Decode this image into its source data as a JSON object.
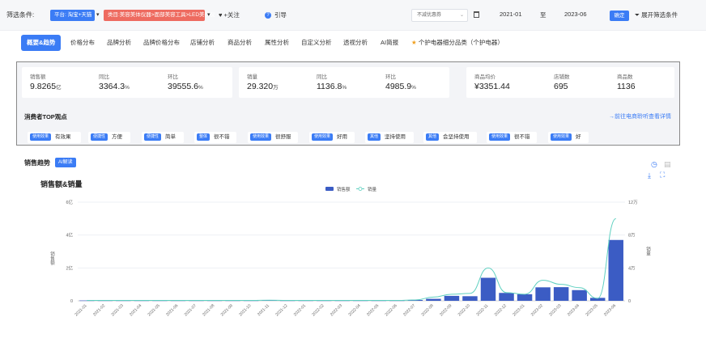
{
  "filter_bar": {
    "label": "筛选条件:",
    "platform_tag": "平台: 淘宝+天猫",
    "category_tag": "类目:美容美体仪器>面部美容工具>LED美容仪",
    "follow": "+关注",
    "guide": "引导",
    "coupon": {
      "value": "不减优惠券"
    },
    "date_from": "2021-01",
    "date_sep": "至",
    "date_to": "2023-06",
    "confirm": "确定",
    "expand": "展开筛选条件"
  },
  "tabs": [
    {
      "label": "概要&趋势",
      "active": true
    },
    {
      "label": "价格分布"
    },
    {
      "label": "品牌分析"
    },
    {
      "label": "品牌价格分布"
    },
    {
      "label": "店铺分析"
    },
    {
      "label": "商品分析"
    },
    {
      "label": "属性分析"
    },
    {
      "label": "自定义分析"
    },
    {
      "label": "透视分析"
    },
    {
      "label": "AI简报"
    },
    {
      "label": "个护电器细分品类（个护电器）",
      "starred": true
    }
  ],
  "metrics": {
    "sales": [
      {
        "label": "销售额",
        "value": "9.8265",
        "unit": "亿"
      },
      {
        "label": "同比",
        "value": "3364.3",
        "unit": "%"
      },
      {
        "label": "环比",
        "value": "39555.6",
        "unit": "%"
      }
    ],
    "volume": [
      {
        "label": "销量",
        "value": "29.320",
        "unit": "万"
      },
      {
        "label": "同比",
        "value": "1136.8",
        "unit": "%"
      },
      {
        "label": "环比",
        "value": "4985.9",
        "unit": "%"
      }
    ],
    "other": [
      {
        "label": "商品均价",
        "value": "¥3351.44"
      },
      {
        "label": "店铺数",
        "value": "695"
      },
      {
        "label": "商品数",
        "value": "1136"
      }
    ]
  },
  "opinions": {
    "title": "消费者TOP观点",
    "link": "→前往电商聆听查看详情",
    "chips": [
      {
        "tag": "使用效果",
        "text": "有效果"
      },
      {
        "tag": "便捷性",
        "text": "方便"
      },
      {
        "tag": "便捷性",
        "text": "简单"
      },
      {
        "tag": "整体",
        "text": "很不错"
      },
      {
        "tag": "使用效果",
        "text": "很舒服"
      },
      {
        "tag": "使用效果",
        "text": "好用"
      },
      {
        "tag": "其他",
        "text": "坚持使用"
      },
      {
        "tag": "其他",
        "text": "会坚持使用"
      },
      {
        "tag": "使用效果",
        "text": "很不错"
      },
      {
        "tag": "使用效果",
        "text": "好"
      }
    ]
  },
  "trend": {
    "title": "销售趋势",
    "ai_badge": "AI解读"
  },
  "chart_data": {
    "type": "bar",
    "title": "销售额&销量",
    "legend": [
      "销售额",
      "销量"
    ],
    "legend_placement": "top-center",
    "ylabel_left": "销售额",
    "ylabel_right": "销量",
    "y_left_ticks": [
      "0",
      "2亿",
      "4亿",
      "6亿"
    ],
    "y_right_ticks": [
      "0",
      "4万",
      "8万",
      "12万"
    ],
    "ylim_left": [
      0,
      6
    ],
    "ylim_right": [
      0,
      12
    ],
    "categories": [
      "2021-01",
      "2021-02",
      "2021-03",
      "2021-04",
      "2021-05",
      "2021-06",
      "2021-07",
      "2021-08",
      "2021-09",
      "2021-10",
      "2021-11",
      "2021-12",
      "2022-01",
      "2022-02",
      "2022-03",
      "2022-04",
      "2022-05",
      "2022-06",
      "2022-07",
      "2022-08",
      "2022-09",
      "2022-10",
      "2022-11",
      "2022-12",
      "2023-01",
      "2023-02",
      "2023-03",
      "2023-04",
      "2023-05",
      "2023-06"
    ],
    "series": [
      {
        "name": "销售额",
        "axis": "left",
        "color": "#3b5cc4",
        "values": [
          0.02,
          0.02,
          0.02,
          0.02,
          0.02,
          0.02,
          0.02,
          0.02,
          0.02,
          0.02,
          0.03,
          0.02,
          0.02,
          0.02,
          0.02,
          0.02,
          0.02,
          0.02,
          0.05,
          0.12,
          0.3,
          0.28,
          1.4,
          0.48,
          0.4,
          0.82,
          0.83,
          0.65,
          0.18,
          3.7
        ]
      },
      {
        "name": "销量",
        "axis": "right",
        "color": "#5fd0c0",
        "values": [
          0.05,
          0.05,
          0.05,
          0.05,
          0.05,
          0.05,
          0.05,
          0.05,
          0.05,
          0.05,
          0.07,
          0.05,
          0.05,
          0.05,
          0.05,
          0.05,
          0.05,
          0.05,
          0.1,
          0.45,
          0.8,
          0.9,
          4.0,
          1.0,
          0.8,
          2.5,
          2.0,
          1.6,
          0.3,
          10.0
        ]
      }
    ]
  },
  "colors": {
    "accent": "#3b7cf5",
    "tag_red": "#ee6b60",
    "bar": "#3b5cc4",
    "line": "#5fd0c0"
  }
}
